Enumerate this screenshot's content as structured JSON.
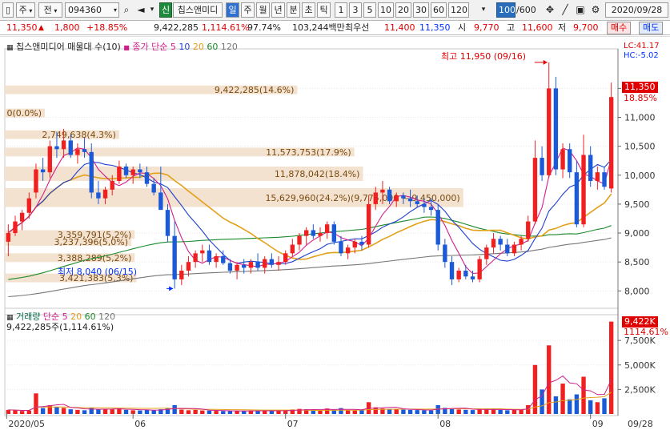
{
  "toolbar": {
    "market": "주",
    "period": "전",
    "code": "094360",
    "badge": "신",
    "company_short": "칩스앤미디",
    "periods": [
      "일",
      "주",
      "월",
      "년",
      "분",
      "초",
      "틱"
    ],
    "minutes": [
      "1",
      "3",
      "5",
      "10",
      "20",
      "30",
      "60",
      "120"
    ],
    "count": "100",
    "count_total": "/600",
    "date": "2020/09/28"
  },
  "quote": {
    "price": "11,350",
    "change": "1,800",
    "change_pct": "+18.85%",
    "volume": "9,422,285",
    "volume_ratio": "1,114.61%",
    "strength": "97.74%",
    "amount": "103,244백만",
    "best_bid_label": "최우선",
    "ask": "11,400",
    "bid": "11,350",
    "open_label": "시",
    "open": "9,770",
    "high_label": "고",
    "high": "11,600",
    "low_label": "저",
    "low": "9,700",
    "buy_label": "매수",
    "sell_label": "매도"
  },
  "legends": {
    "main_title": "칩스앤미디어 매물대 수(10)",
    "ma_label": "종가 단순",
    "ma_periods": [
      "5",
      "10",
      "20",
      "60",
      "120"
    ],
    "lc": "LC:41.17",
    "hc": "HC:-5.02",
    "vol_title": "거래량",
    "vol_ma_label": "단순",
    "vol_periods": [
      "5",
      "20",
      "60",
      "120"
    ],
    "vol_value": "9,422,285주(1,114.61%)"
  },
  "colors": {
    "up": "#f02020",
    "down": "#1a5ad8",
    "ma5": "#d0208c",
    "ma10": "#1e3fcf",
    "ma20": "#e3a019",
    "ma60": "#1a8a2a",
    "ma120": "#777777",
    "profile": "#f3e2cf"
  },
  "annotations": {
    "high": "최고 11,950 (09/16)",
    "low": "최저 8,040 (06/15)",
    "price_tag": "11,350",
    "pct_tag": "18.85%",
    "vol_tag": "9,422K",
    "vol_pct_tag": "1114.61%"
  },
  "chart_data": {
    "type": "candlestick",
    "price_axis": {
      "labels": [
        "11,500",
        "11,000",
        "10,500",
        "10,000",
        "9,500",
        "9,000",
        "8,500",
        "8,000"
      ],
      "values": [
        11500,
        11000,
        10500,
        10000,
        9500,
        9000,
        8500,
        8000
      ],
      "range": [
        7700,
        12100
      ]
    },
    "volume_axis": {
      "labels": [
        "7,500K",
        "5,000K",
        "2,500K"
      ],
      "values": [
        7500,
        5000,
        2500
      ],
      "range": [
        0,
        9800
      ]
    },
    "x_labels": [
      "2020/05",
      "06",
      "07",
      "08",
      "09",
      "09/28"
    ],
    "volume_profile": [
      {
        "label": "9,422,285(14.6%)",
        "low": 11400,
        "high": 11550,
        "share": 14.6
      },
      {
        "label": "0(0.0%)",
        "low": 11000,
        "high": 11150,
        "share": 0.0
      },
      {
        "label": "2,749,638(4.3%)",
        "low": 10625,
        "high": 10775,
        "share": 4.3
      },
      {
        "label": "11,573,753(17.9%)",
        "low": 10325,
        "high": 10475,
        "share": 17.9
      },
      {
        "label": "11,878,042(18.4%)",
        "low": 9900,
        "high": 10150,
        "share": 18.4
      },
      {
        "label": "15,629,960(24.2%)(9,775,000 ~ 9,450,000)",
        "low": 9450,
        "high": 9775,
        "share": 24.2
      },
      {
        "label": "3,359,791(5,2%)",
        "low": 8900,
        "high": 9050,
        "share": 5.2
      },
      {
        "label": "3,237,396(5,0%)",
        "low": 8780,
        "high": 8920,
        "share": 5.0
      },
      {
        "label": "3,388,289(5,2%)",
        "low": 8500,
        "high": 8650,
        "share": 5.2
      },
      {
        "label": "3,421,383(5,3%)",
        "low": 8150,
        "high": 8300,
        "share": 5.3
      }
    ],
    "candles": [
      [
        8850,
        9150,
        8600,
        9000
      ],
      [
        9000,
        9300,
        8950,
        9200
      ],
      [
        9200,
        9400,
        9050,
        9350
      ],
      [
        9350,
        9700,
        9250,
        9600
      ],
      [
        9700,
        10200,
        9600,
        10100
      ],
      [
        10100,
        10300,
        9900,
        10050
      ],
      [
        10050,
        10600,
        9950,
        10500
      ],
      [
        10500,
        10750,
        10300,
        10450
      ],
      [
        10450,
        10800,
        10300,
        10600
      ],
      [
        10600,
        10700,
        10300,
        10350
      ],
      [
        10350,
        10550,
        10200,
        10450
      ],
      [
        10450,
        10650,
        10300,
        10400
      ],
      [
        10400,
        10550,
        9600,
        9700
      ],
      [
        9700,
        9900,
        9500,
        9600
      ],
      [
        9600,
        9800,
        9500,
        9750
      ],
      [
        9750,
        10000,
        9650,
        9900
      ],
      [
        9900,
        10250,
        9850,
        10150
      ],
      [
        10150,
        10200,
        9950,
        10000
      ],
      [
        10000,
        10150,
        9850,
        10100
      ],
      [
        10100,
        10200,
        9950,
        10050
      ],
      [
        10050,
        10150,
        9800,
        9850
      ],
      [
        9850,
        9950,
        9650,
        9700
      ],
      [
        9700,
        10150,
        9500,
        9400
      ],
      [
        9400,
        9500,
        8850,
        8950
      ],
      [
        8950,
        9200,
        8040,
        8200
      ],
      [
        8200,
        8450,
        8100,
        8350
      ],
      [
        8350,
        8600,
        8250,
        8500
      ],
      [
        8500,
        8700,
        8400,
        8650
      ],
      [
        8650,
        8800,
        8500,
        8700
      ],
      [
        8700,
        8800,
        8450,
        8500
      ],
      [
        8500,
        8650,
        8400,
        8600
      ],
      [
        8600,
        8700,
        8450,
        8480
      ],
      [
        8480,
        8550,
        8300,
        8350
      ],
      [
        8350,
        8500,
        8200,
        8450
      ],
      [
        8450,
        8550,
        8300,
        8400
      ],
      [
        8400,
        8550,
        8300,
        8500
      ],
      [
        8500,
        8650,
        8350,
        8400
      ],
      [
        8400,
        8600,
        8300,
        8550
      ],
      [
        8550,
        8650,
        8400,
        8450
      ],
      [
        8450,
        8600,
        8350,
        8500
      ],
      [
        8500,
        8700,
        8450,
        8650
      ],
      [
        8650,
        8900,
        8600,
        8800
      ],
      [
        8800,
        9000,
        8700,
        8950
      ],
      [
        8950,
        9100,
        8800,
        9050
      ],
      [
        9050,
        9150,
        8900,
        8950
      ],
      [
        8950,
        9100,
        8850,
        9000
      ],
      [
        9000,
        9200,
        8900,
        9150
      ],
      [
        9150,
        9200,
        8800,
        8850
      ],
      [
        8850,
        8950,
        8600,
        8650
      ],
      [
        8650,
        8800,
        8550,
        8750
      ],
      [
        8750,
        8900,
        8650,
        8850
      ],
      [
        8850,
        8950,
        8700,
        8800
      ],
      [
        8800,
        9650,
        8750,
        9500
      ],
      [
        9500,
        9800,
        9400,
        9700
      ],
      [
        9700,
        9900,
        9500,
        9750
      ],
      [
        9750,
        9800,
        9500,
        9550
      ],
      [
        9550,
        9700,
        9450,
        9650
      ],
      [
        9650,
        9700,
        9500,
        9600
      ],
      [
        9600,
        9750,
        9450,
        9550
      ],
      [
        9550,
        9650,
        9450,
        9500
      ],
      [
        9500,
        9600,
        9350,
        9450
      ],
      [
        9450,
        9600,
        9300,
        9400
      ],
      [
        9400,
        9500,
        8700,
        8800
      ],
      [
        8800,
        8900,
        8400,
        8500
      ],
      [
        8500,
        8600,
        8100,
        8200
      ],
      [
        8200,
        8400,
        8150,
        8350
      ],
      [
        8350,
        8450,
        8200,
        8250
      ],
      [
        8250,
        8350,
        8150,
        8200
      ],
      [
        8200,
        8600,
        8150,
        8550
      ],
      [
        8550,
        8800,
        8450,
        8750
      ],
      [
        8750,
        9000,
        8650,
        8900
      ],
      [
        8900,
        8950,
        8700,
        8800
      ],
      [
        8800,
        8900,
        8600,
        8650
      ],
      [
        8650,
        8850,
        8600,
        8800
      ],
      [
        8800,
        8950,
        8700,
        8900
      ],
      [
        8900,
        9300,
        8850,
        9200
      ],
      [
        9200,
        10600,
        9150,
        10300
      ],
      [
        10300,
        10500,
        9900,
        10000
      ],
      [
        10000,
        11950,
        9950,
        11500
      ],
      [
        11500,
        11700,
        10000,
        10100
      ],
      [
        10100,
        10550,
        9950,
        10450
      ],
      [
        10450,
        10550,
        9950,
        10050
      ],
      [
        10050,
        10250,
        9100,
        9150
      ],
      [
        9150,
        10700,
        9100,
        10350
      ],
      [
        10350,
        10500,
        9800,
        9900
      ],
      [
        9900,
        10150,
        9750,
        10050
      ],
      [
        10050,
        10150,
        9750,
        9800
      ],
      [
        9770,
        11600,
        9700,
        11350
      ]
    ],
    "volumes": [
      420,
      380,
      310,
      350,
      2100,
      600,
      900,
      700,
      620,
      480,
      420,
      380,
      650,
      460,
      520,
      480,
      560,
      420,
      380,
      360,
      420,
      390,
      480,
      620,
      900,
      450,
      380,
      420,
      360,
      340,
      320,
      300,
      330,
      310,
      300,
      340,
      320,
      360,
      300,
      330,
      380,
      460,
      520,
      480,
      420,
      400,
      560,
      420,
      600,
      380,
      350,
      370,
      1200,
      680,
      560,
      520,
      460,
      440,
      420,
      400,
      380,
      360,
      900,
      620,
      540,
      460,
      420,
      400,
      520,
      480,
      460,
      420,
      380,
      440,
      460,
      900,
      5000,
      2500,
      7000,
      1800,
      3100,
      1500,
      2000,
      3800,
      1400,
      1200,
      1600,
      9422
    ],
    "ma_note": "moving averages 5,10,20,60,120 (price) and 5,20 (volume)"
  }
}
